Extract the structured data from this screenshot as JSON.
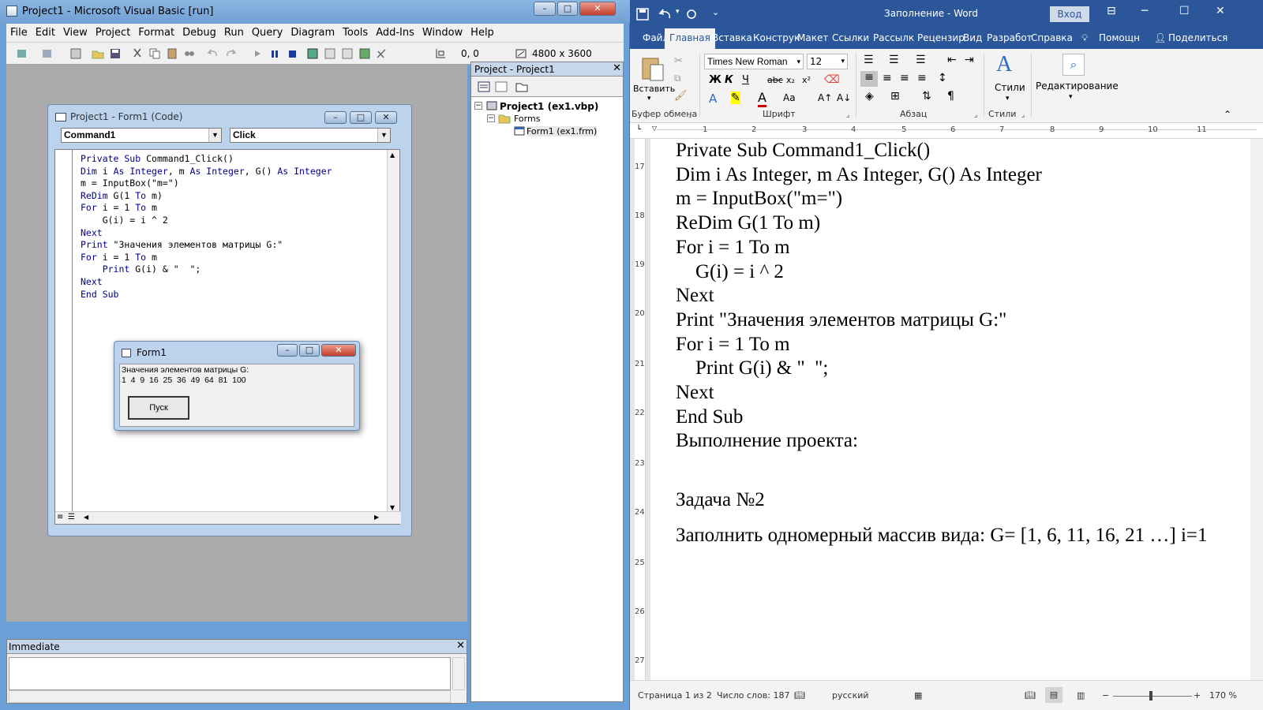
{
  "vb": {
    "title": "Project1 - Microsoft Visual Basic [run]",
    "menu": [
      "File",
      "Edit",
      "View",
      "Project",
      "Format",
      "Debug",
      "Run",
      "Query",
      "Diagram",
      "Tools",
      "Add-Ins",
      "Window",
      "Help"
    ],
    "coords": "0, 0",
    "size": "4800 x 3600",
    "code_window": {
      "title": "Project1 - Form1 (Code)",
      "object_combo": "Command1",
      "proc_combo": "Click",
      "lines": [
        "Private Sub Command1_Click()",
        "Dim i As Integer, m As Integer, G() As Integer",
        "m = InputBox(\"m=\")",
        "ReDim G(1 To m)",
        "For i = 1 To m",
        "    G(i) = i ^ 2",
        "Next",
        "Print \"Значения элементов матрицы G:\"",
        "For i = 1 To m",
        "    Print G(i) & \"  \";",
        "Next",
        "End Sub"
      ]
    },
    "form1": {
      "title": "Form1",
      "output_line1": "Значения элементов матрицы G:",
      "output_line2": "1  4  9  16  25  36  49  64  81  100",
      "button": "Пуск"
    },
    "project_panel": {
      "title": "Project - Project1",
      "root": "Project1 (ex1.vbp)",
      "folder": "Forms",
      "item": "Form1 (ex1.frm)"
    },
    "immediate": {
      "title": "Immediate"
    }
  },
  "word": {
    "title": "Заполнение - Word",
    "login": "Вход",
    "tabs": [
      "Файл",
      "Главная",
      "Вставка",
      "Конструк",
      "Макет",
      "Ссылки",
      "Рассылк",
      "Рецензир",
      "Вид",
      "Разработ",
      "Справка",
      "Помощн",
      "Поделиться"
    ],
    "ribbon": {
      "paste": "Вставить",
      "font_name": "Times New Roman",
      "font_size": "12",
      "styles": "Стили",
      "editing": "Редактирование",
      "groups": [
        "Буфер обмена",
        "Шрифт",
        "Абзац",
        "Стили"
      ]
    },
    "ruler_numbers": [
      "1",
      "2",
      "3",
      "4",
      "5",
      "6",
      "7",
      "8",
      "9",
      "10",
      "11"
    ],
    "vruler_numbers": [
      "17",
      "18",
      "19",
      "20",
      "21",
      "22",
      "23",
      "24",
      "25",
      "26",
      "27"
    ],
    "doc_lines": [
      "Private Sub Command1_Click()",
      "Dim i As Integer, m As Integer, G() As Integer",
      "m = InputBox(\"m=\")",
      "ReDim G(1 To m)",
      "For i = 1 To m",
      "    G(i) = i ^ 2",
      "Next",
      "Print \"Значения элементов матрицы G:\"",
      "For i = 1 To m",
      "    Print G(i) & \"  \";",
      "Next",
      "End Sub",
      "Выполнение проекта:"
    ],
    "task_title": "Задача №2",
    "task_text": "Заполнить одномерный массив вида: G= [1, 6, 11, 16, 21 …] i=1",
    "status": {
      "page": "Страница 1 из 2",
      "words": "Число слов: 187",
      "lang": "русский",
      "zoom": "170 %"
    }
  }
}
